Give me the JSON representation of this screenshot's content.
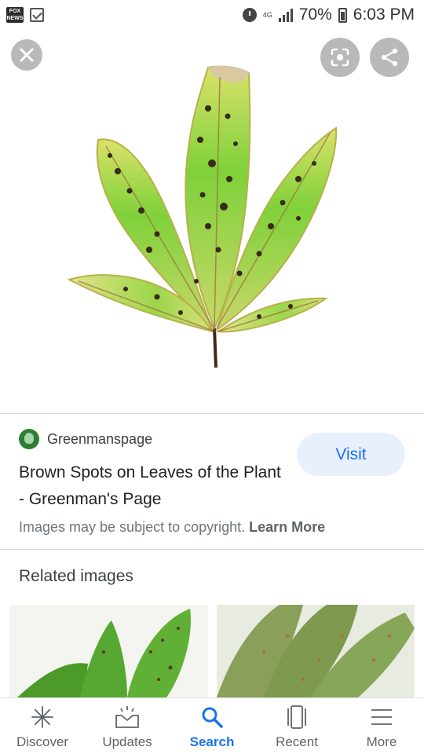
{
  "status_bar": {
    "app_icon": "fox-news-icon",
    "fox_text_top": "FOX",
    "fox_text_bottom": "NEWS",
    "network": "4G",
    "battery_percent": "70%",
    "time": "6:03 PM"
  },
  "viewer": {
    "close_icon": "close-icon",
    "lens_icon": "lens-icon",
    "share_icon": "share-icon"
  },
  "source": {
    "name": "Greenmanspage",
    "title": "Brown Spots on Leaves of the Plant - Greenman's Page",
    "visit_label": "Visit",
    "copyright_text": "Images may be subject to copyright.",
    "learn_more": "Learn More"
  },
  "related": {
    "heading": "Related images"
  },
  "bottom_nav": [
    {
      "label": "Discover",
      "icon": "asterisk-icon",
      "active": false
    },
    {
      "label": "Updates",
      "icon": "inbox-icon",
      "active": false
    },
    {
      "label": "Search",
      "icon": "search-icon",
      "active": true
    },
    {
      "label": "Recent",
      "icon": "recent-cards-icon",
      "active": false
    },
    {
      "label": "More",
      "icon": "menu-icon",
      "active": false
    }
  ],
  "colors": {
    "accent": "#1a73e8",
    "visit_bg": "#e8f0fe",
    "overlay_button": "#b9b9b9"
  }
}
